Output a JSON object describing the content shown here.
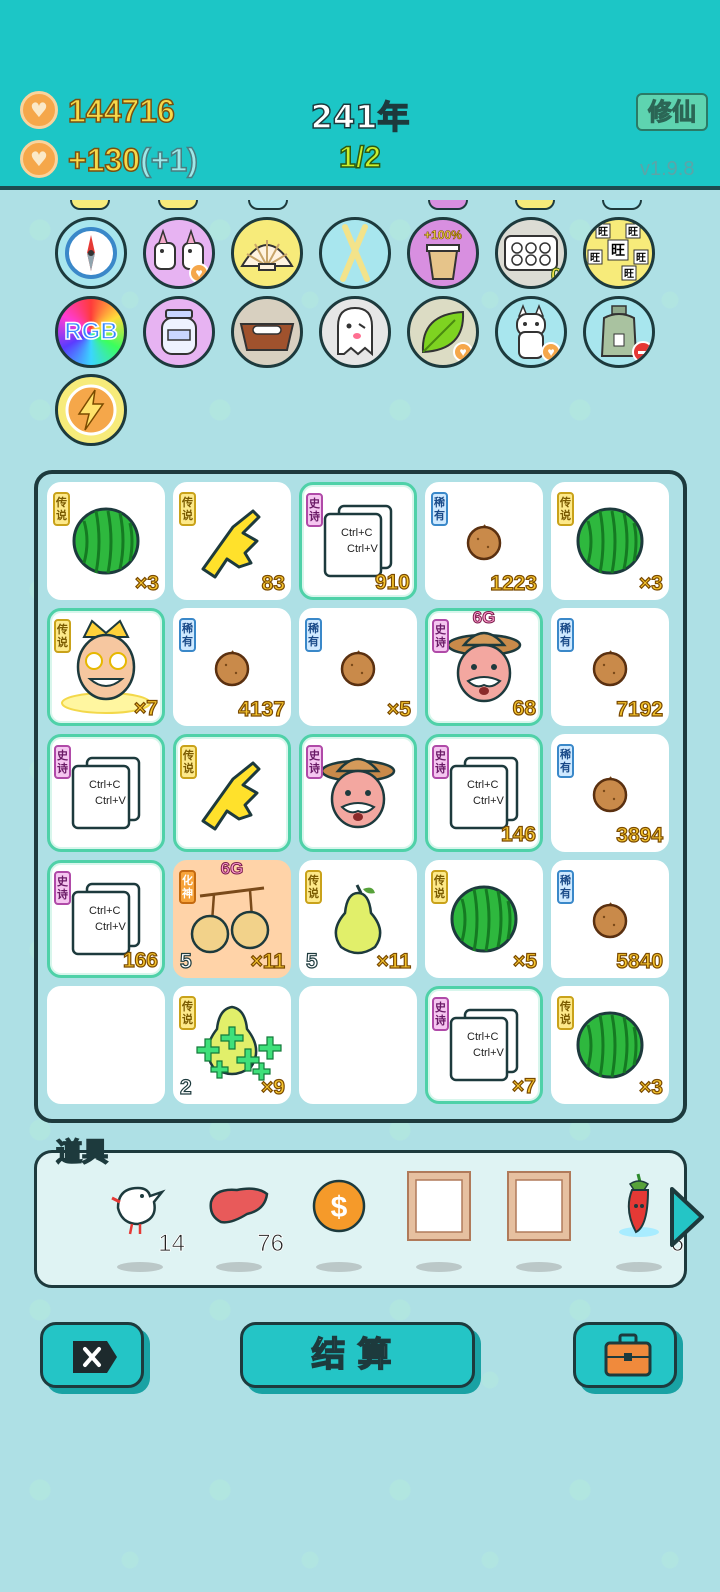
{
  "header": {
    "coins": "144716",
    "income": "+130",
    "income_bonus": "(+1)",
    "year": "241年",
    "progress": "1/2",
    "cultivate_label": "修仙",
    "version": "v1.9.8"
  },
  "relics": [
    {
      "icon": "compass-icon",
      "color": "#a8e6ee"
    },
    {
      "icon": "unicorn-twins-icon",
      "color": "#e7b3f2",
      "badge": "heart"
    },
    {
      "icon": "shell-icon",
      "color": "#f7eb7a"
    },
    {
      "icon": "chopsticks-icon",
      "color": "#a8e6ee"
    },
    {
      "icon": "bucket-icon",
      "color": "#d88fe0",
      "label": "+100%"
    },
    {
      "icon": "egg-carton-icon",
      "color": "#dcdcd4",
      "badge": "0"
    },
    {
      "icon": "wang-dice-icon",
      "color": "#f7eb7a",
      "label": "旺"
    },
    {
      "icon": "rgb-icon",
      "color": "rainbow",
      "label": "RGB"
    },
    {
      "icon": "jar-icon",
      "color": "#e7b3f2"
    },
    {
      "icon": "dog-bowl-icon",
      "color": "#d8d0c0"
    },
    {
      "icon": "ghost-icon",
      "color": "#e6e6e6"
    },
    {
      "icon": "leaf-icon",
      "color": "#dcdcc4",
      "badge": "heart"
    },
    {
      "icon": "cat-icon",
      "color": "#a8e6ee",
      "badge": "heart"
    },
    {
      "icon": "sack-icon",
      "color": "#a8e6ee",
      "badge": "minus"
    },
    {
      "icon": "lightning-icon",
      "color": "#f7eb7a"
    }
  ],
  "grid": [
    [
      {
        "rarity": "传说",
        "rclass": "r-legend",
        "item": "watermelon-icon",
        "count": "×3"
      },
      {
        "rarity": "传说",
        "rclass": "r-legend",
        "item": "pointing-hand-icon",
        "count": "83"
      },
      {
        "rarity": "史诗",
        "rclass": "r-epic",
        "item": "copy-paste-icon",
        "count": "910",
        "epic": true
      },
      {
        "rarity": "稀有",
        "rclass": "r-rare",
        "item": "nut-icon",
        "count": "1223"
      },
      {
        "rarity": "传说",
        "rclass": "r-legend",
        "item": "watermelon-icon",
        "count": "×3"
      }
    ],
    [
      {
        "rarity": "传说",
        "rclass": "r-legend",
        "item": "king-icon",
        "count": "×7",
        "epic": true
      },
      {
        "rarity": "稀有",
        "rclass": "r-rare",
        "item": "nut-icon",
        "count": "4137"
      },
      {
        "rarity": "稀有",
        "rclass": "r-rare",
        "item": "nut-icon",
        "count": "×5"
      },
      {
        "rarity": "史诗",
        "rclass": "r-epic",
        "item": "farmer-icon",
        "count": "68",
        "tag": "6G",
        "epic": true
      },
      {
        "rarity": "稀有",
        "rclass": "r-rare",
        "item": "nut-icon",
        "count": "7192"
      }
    ],
    [
      {
        "rarity": "史诗",
        "rclass": "r-epic",
        "item": "copy-paste-icon",
        "count": "",
        "epic": true
      },
      {
        "rarity": "传说",
        "rclass": "r-legend",
        "item": "pointing-hand-icon",
        "count": "",
        "epic": true
      },
      {
        "rarity": "史诗",
        "rclass": "r-epic",
        "item": "farmer-icon",
        "count": "",
        "epic": true
      },
      {
        "rarity": "史诗",
        "rclass": "r-epic",
        "item": "copy-paste-icon",
        "count": "146",
        "epic": true
      },
      {
        "rarity": "稀有",
        "rclass": "r-rare",
        "item": "nut-icon",
        "count": "3894"
      }
    ],
    [
      {
        "rarity": "史诗",
        "rclass": "r-epic",
        "item": "copy-paste-icon",
        "count": "166",
        "epic": true
      },
      {
        "rarity": "化神",
        "rclass": "r-huashen",
        "item": "cherries-icon",
        "count": "×11",
        "level": "5",
        "tag": "6G",
        "orange": true
      },
      {
        "rarity": "传说",
        "rclass": "r-legend",
        "item": "pear-icon",
        "count": "×11",
        "level": "5"
      },
      {
        "rarity": "传说",
        "rclass": "r-legend",
        "item": "watermelon-icon",
        "count": "×5"
      },
      {
        "rarity": "稀有",
        "rclass": "r-rare",
        "item": "nut-icon",
        "count": "5840"
      }
    ],
    [
      {
        "empty": true
      },
      {
        "rarity": "传说",
        "rclass": "r-legend",
        "item": "pear-plus-icon",
        "count": "×9",
        "level": "2"
      },
      {
        "empty": true
      },
      {
        "rarity": "史诗",
        "rclass": "r-epic",
        "item": "copy-paste-icon",
        "count": "×7",
        "epic": true
      },
      {
        "rarity": "传说",
        "rclass": "r-legend",
        "item": "watermelon-icon",
        "count": "×3"
      }
    ]
  ],
  "items": {
    "title": "道具",
    "slots": [
      {
        "icon": "dove-icon",
        "count": "14"
      },
      {
        "icon": "liver-icon",
        "count": "76"
      },
      {
        "icon": "dollar-coin-icon",
        "count": ""
      },
      {
        "icon": "frame-icon",
        "count": ""
      },
      {
        "icon": "frame-icon",
        "count": ""
      },
      {
        "icon": "chili-pepper-icon",
        "count": "6"
      }
    ]
  },
  "buttons": {
    "settle_label": "结算"
  },
  "copy_paste_text": {
    "line1": "Ctrl+C",
    "line2": "Ctrl+V"
  }
}
